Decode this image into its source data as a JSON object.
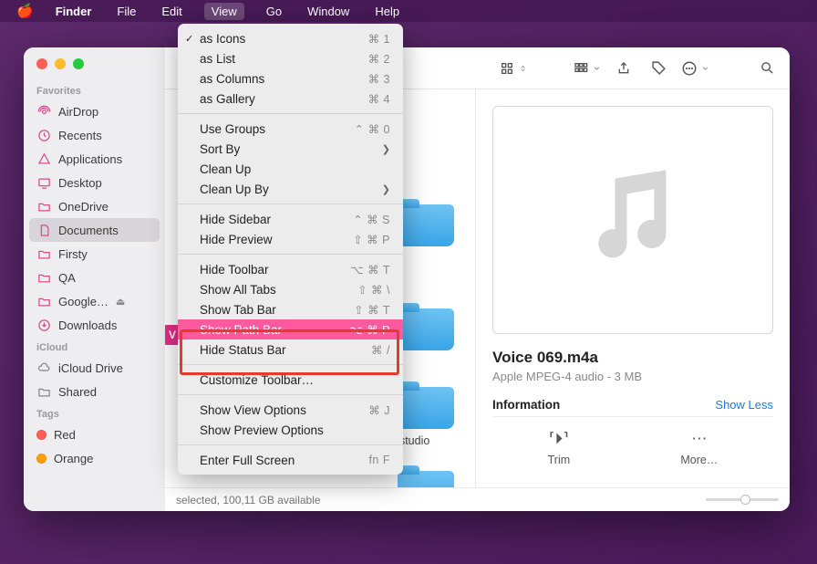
{
  "menubar": {
    "app": "Finder",
    "items": [
      "File",
      "Edit",
      "View",
      "Go",
      "Window",
      "Help"
    ],
    "active_index": 2
  },
  "view_menu": {
    "items": [
      {
        "label": "as Icons",
        "short": "⌘ 1",
        "checked": true
      },
      {
        "label": "as List",
        "short": "⌘ 2"
      },
      {
        "label": "as Columns",
        "short": "⌘ 3"
      },
      {
        "label": "as Gallery",
        "short": "⌘ 4"
      },
      {
        "sep": true
      },
      {
        "label": "Use Groups",
        "short": "⌃ ⌘ 0"
      },
      {
        "label": "Sort By",
        "submenu": true
      },
      {
        "label": "Clean Up"
      },
      {
        "label": "Clean Up By",
        "submenu": true
      },
      {
        "sep": true
      },
      {
        "label": "Hide Sidebar",
        "short": "⌃ ⌘ S"
      },
      {
        "label": "Hide Preview",
        "short": "⇧ ⌘ P"
      },
      {
        "sep": true
      },
      {
        "label": "Hide Toolbar",
        "short": "⌥ ⌘ T"
      },
      {
        "label": "Show All Tabs",
        "short": "⇧ ⌘ \\"
      },
      {
        "label": "Show Tab Bar",
        "short": "⇧ ⌘ T"
      },
      {
        "label": "Show Path Bar",
        "short": "⌥ ⌘ P",
        "highlighted": true
      },
      {
        "label": "Hide Status Bar",
        "short": "⌘ /"
      },
      {
        "sep": true
      },
      {
        "label": "Customize Toolbar…"
      },
      {
        "sep": true
      },
      {
        "label": "Show View Options",
        "short": "⌘ J"
      },
      {
        "label": "Show Preview Options"
      },
      {
        "sep": true
      },
      {
        "label": "Enter Full Screen",
        "short": "fn F"
      }
    ]
  },
  "sidebar": {
    "sections": {
      "favorites": "Favorites",
      "icloud": "iCloud",
      "tags": "Tags"
    },
    "favorites": [
      {
        "label": "AirDrop"
      },
      {
        "label": "Recents"
      },
      {
        "label": "Applications"
      },
      {
        "label": "Desktop"
      },
      {
        "label": "OneDrive"
      },
      {
        "label": "Documents",
        "selected": true
      },
      {
        "label": "Firsty"
      },
      {
        "label": "QA"
      },
      {
        "label": "Google…",
        "ejectable": true
      },
      {
        "label": "Downloads"
      }
    ],
    "icloud": [
      {
        "label": "iCloud Drive"
      },
      {
        "label": "Shared"
      }
    ],
    "tags": [
      {
        "label": "Red",
        "color": "#ff5f57"
      },
      {
        "label": "Orange",
        "color": "#ff9f0a"
      }
    ]
  },
  "content": {
    "partial_v": "V",
    "partial_estudio": "estudio"
  },
  "preview": {
    "filename": "Voice 069.m4a",
    "meta": "Apple MPEG-4 audio - 3 MB",
    "info_label": "Information",
    "show_less": "Show Less",
    "action_trim": "Trim",
    "action_more": "More…"
  },
  "status": {
    "text": "selected, 100,11 GB available"
  }
}
